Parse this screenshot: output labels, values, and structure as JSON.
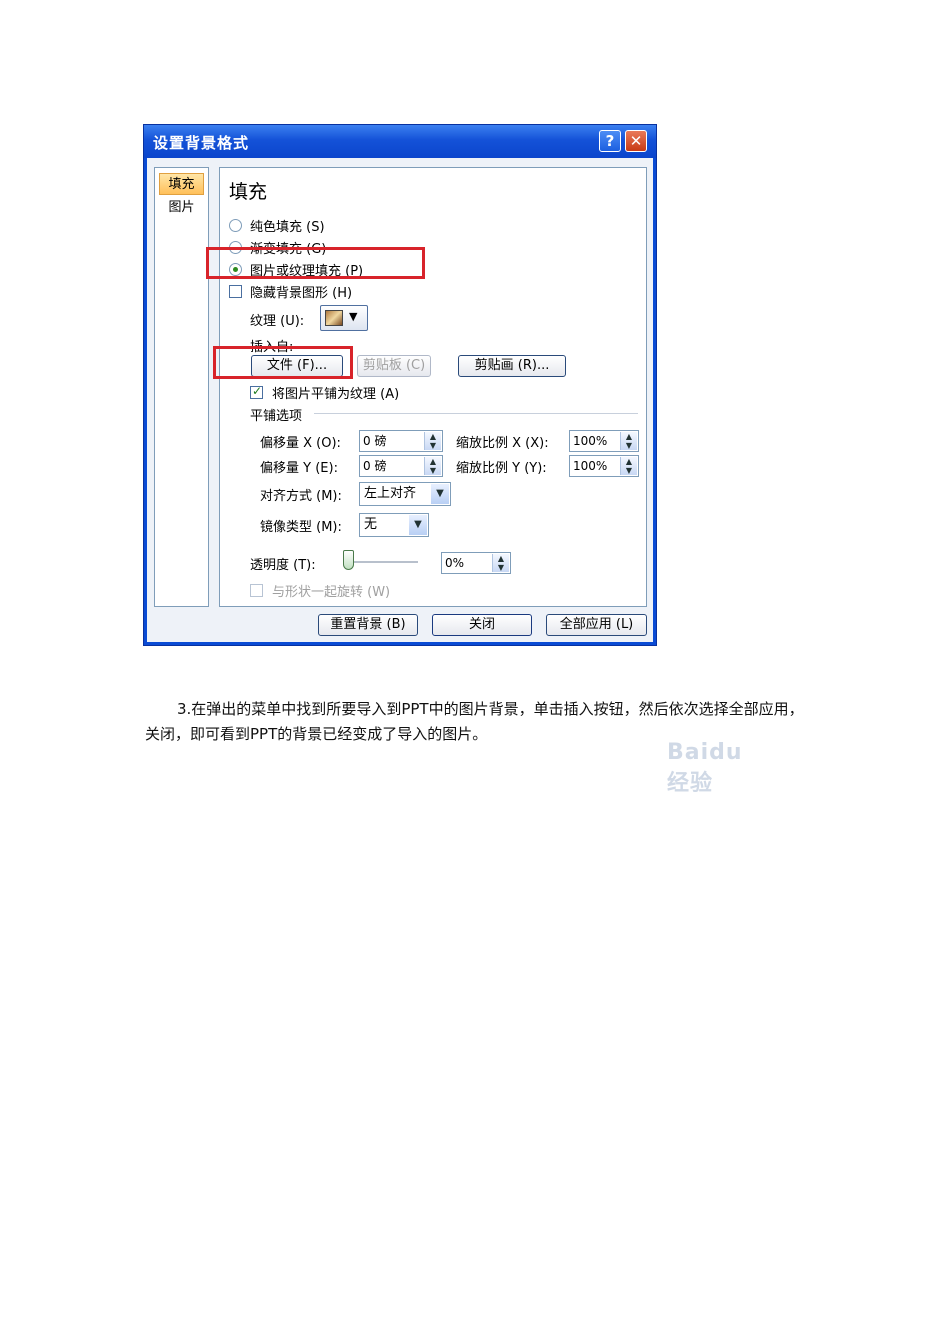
{
  "dialog": {
    "title": "设置背景格式",
    "help": "?",
    "close": "✕",
    "nav": {
      "fill": "填充",
      "picture": "图片"
    },
    "panel_title": "填充",
    "options": {
      "solid": "纯色填充 (S)",
      "gradient": "渐变填充 (G)",
      "picture_texture": "图片或纹理填充 (P)",
      "hide_background": "隐藏背景图形 (H)"
    },
    "texture_label": "纹理 (U):",
    "insert_from_label": "插入自:",
    "buttons": {
      "file": "文件 (F)...",
      "clipboard": "剪贴板 (C)",
      "clip_art": "剪贴画 (R)..."
    },
    "tile_checkbox": "将图片平铺为纹理 (A)",
    "tiling_options_label": "平铺选项",
    "offset_x_label": "偏移量 X (O):",
    "offset_x_value": "0 磅",
    "offset_y_label": "偏移量 Y (E):",
    "offset_y_value": "0 磅",
    "scale_x_label": "缩放比例 X (X):",
    "scale_x_value": "100%",
    "scale_y_label": "缩放比例 Y (Y):",
    "scale_y_value": "100%",
    "alignment_label": "对齐方式 (M):",
    "alignment_value": "左上对齐",
    "mirror_label": "镜像类型 (M):",
    "mirror_value": "无",
    "transparency_label": "透明度 (T):",
    "transparency_value": "0%",
    "transparency_level": 0,
    "rotate_checkbox": "与形状一起旋转 (W)",
    "footer": {
      "reset": "重置背景 (B)",
      "close": "关闭",
      "apply_all": "全部应用 (L)"
    }
  },
  "watermark": "Baidu 经验",
  "caption": "3.在弹出的菜单中找到所要导入到PPT中的图片背景，单击插入按钮，然后依次选择全部应用，关闭，即可看到PPT的背景已经变成了导入的图片。",
  "colors": {
    "highlight": "#d8232a",
    "titlebar": "#1452d8"
  }
}
